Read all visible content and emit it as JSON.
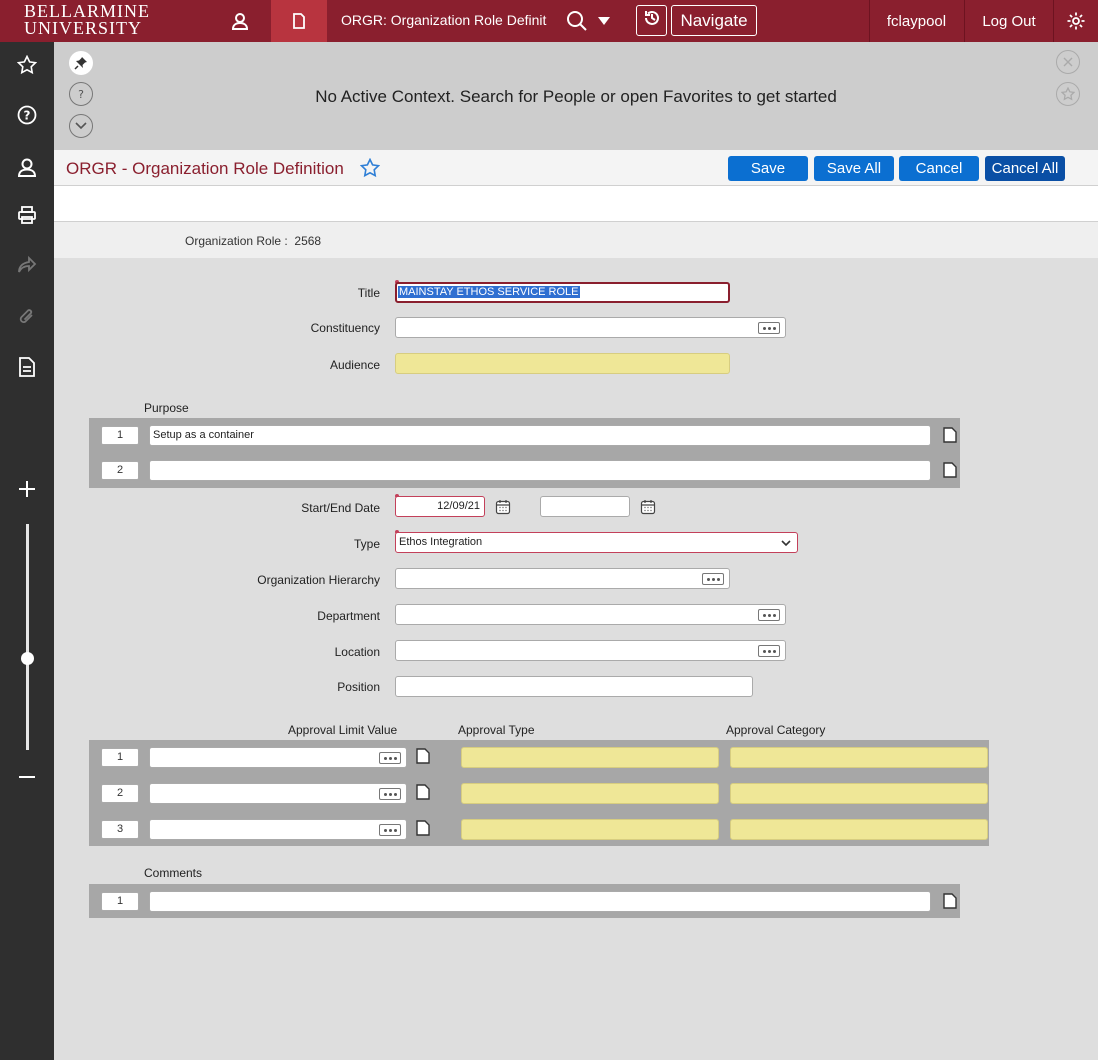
{
  "topbar": {
    "logo_line1": "BELLARMINE",
    "logo_line2": "UNIVERSITY",
    "page_tab_title": "ORGR: Organization Role Definit",
    "navigate_label": "Navigate",
    "username": "fclaypool",
    "logout_label": "Log Out"
  },
  "context": {
    "message": "No Active Context. Search for People or open Favorites to get started"
  },
  "header": {
    "title": "ORGR - Organization Role Definition",
    "save_label": "Save",
    "save_all_label": "Save All",
    "cancel_label": "Cancel",
    "cancel_all_label": "Cancel All"
  },
  "key": {
    "label": "Organization Role :",
    "value": "2568"
  },
  "form": {
    "title_label": "Title",
    "title_value": "MAINSTAY ETHOS SERVICE ROLE",
    "constituency_label": "Constituency",
    "constituency_value": "",
    "audience_label": "Audience",
    "audience_value": "",
    "purpose_label": "Purpose",
    "purpose_rows": [
      {
        "num": "1",
        "value": "Setup as a container"
      },
      {
        "num": "2",
        "value": ""
      }
    ],
    "start_end_label": "Start/End Date",
    "start_date": "12/09/21",
    "end_date": "",
    "type_label": "Type",
    "type_value": "Ethos Integration",
    "org_hierarchy_label": "Organization Hierarchy",
    "org_hierarchy_value": "",
    "department_label": "Department",
    "department_value": "",
    "location_label": "Location",
    "location_value": "",
    "position_label": "Position",
    "position_value": "",
    "approval_limit_header": "Approval Limit Value",
    "approval_type_header": "Approval Type",
    "approval_category_header": "Approval Category",
    "approval_rows": [
      {
        "num": "1",
        "limit": "",
        "type": "",
        "category": ""
      },
      {
        "num": "2",
        "limit": "",
        "type": "",
        "category": ""
      },
      {
        "num": "3",
        "limit": "",
        "type": "",
        "category": ""
      }
    ],
    "comments_label": "Comments",
    "comments_rows": [
      {
        "num": "1",
        "value": ""
      }
    ]
  },
  "icons": {
    "user": "user-icon",
    "page": "page-icon",
    "search": "search-icon",
    "history": "history-icon",
    "settings": "gear-icon",
    "favorites": "star-icon",
    "help": "help-icon",
    "print": "printer-icon",
    "share": "share-icon",
    "attach": "paperclip-icon",
    "document": "document-icon"
  },
  "colors": {
    "brand": "#8a1f2e",
    "button_blue": "#0b6fd1",
    "required_yellow": "#efe797"
  }
}
